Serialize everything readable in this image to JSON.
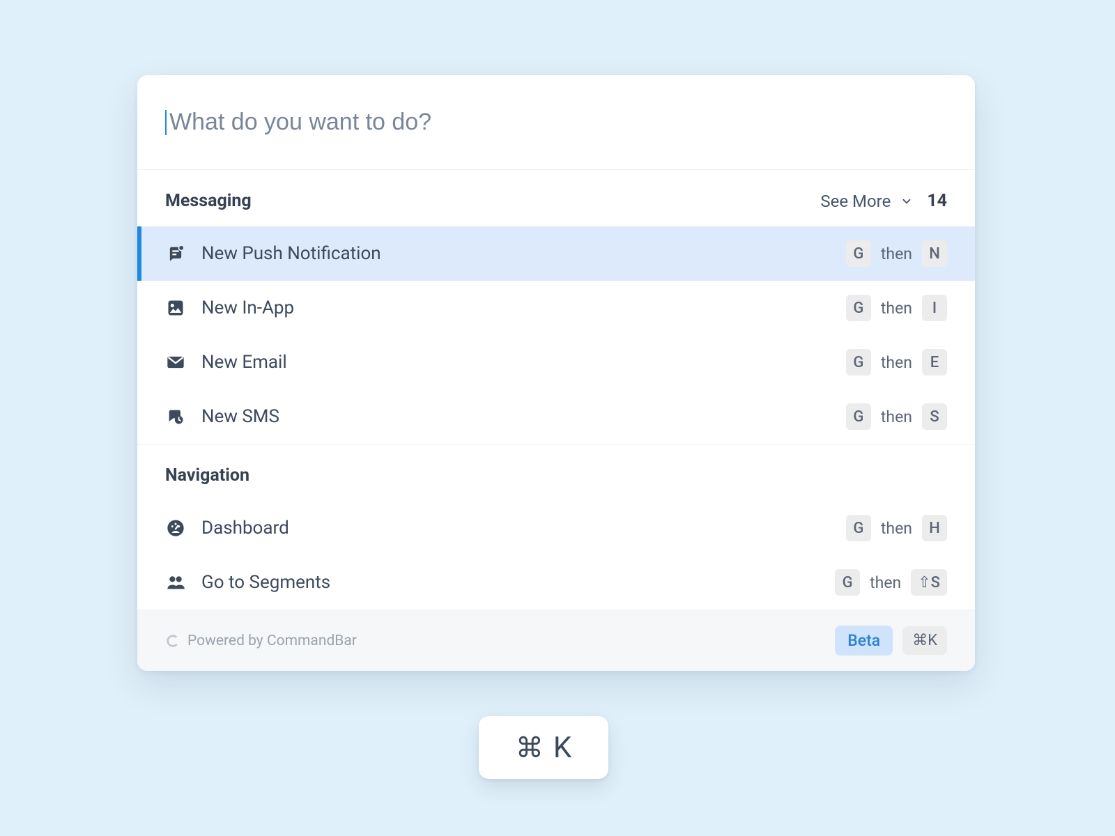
{
  "search": {
    "placeholder": "What do you want to do?"
  },
  "sections": {
    "messaging": {
      "title": "Messaging",
      "see_more_label": "See More",
      "count": "14",
      "items": [
        {
          "label": "New Push Notification",
          "key1": "G",
          "then": "then",
          "key2": "N"
        },
        {
          "label": "New In-App",
          "key1": "G",
          "then": "then",
          "key2": "I"
        },
        {
          "label": "New Email",
          "key1": "G",
          "then": "then",
          "key2": "E"
        },
        {
          "label": "New SMS",
          "key1": "G",
          "then": "then",
          "key2": "S"
        }
      ]
    },
    "navigation": {
      "title": "Navigation",
      "items": [
        {
          "label": "Dashboard",
          "key1": "G",
          "then": "then",
          "key2": "H"
        },
        {
          "label": "Go to Segments",
          "key1": "G",
          "then": "then",
          "key2": "⇧S"
        }
      ]
    }
  },
  "footer": {
    "powered_by": "Powered by CommandBar",
    "beta": "Beta",
    "shortcut": "⌘K"
  },
  "standalone": {
    "cmd": "⌘",
    "key": "K"
  }
}
